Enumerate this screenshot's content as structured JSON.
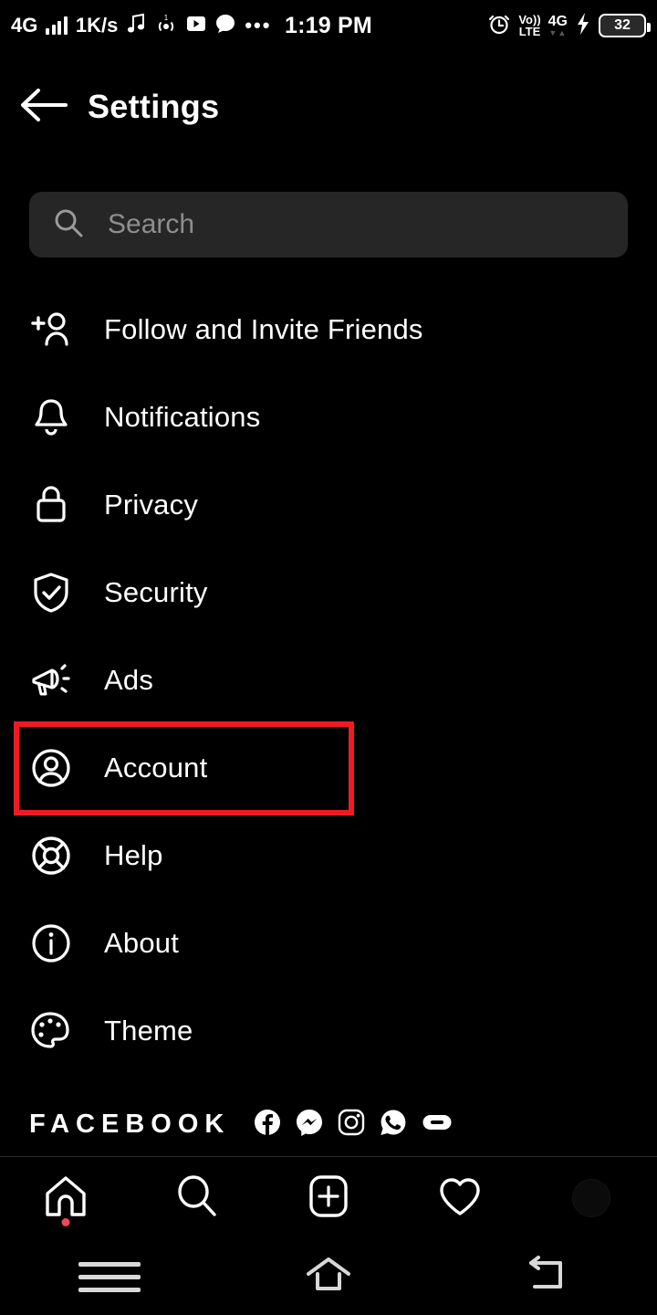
{
  "status_bar": {
    "network_type": "4G",
    "data_rate": "1K/s",
    "icons_left": [
      "signal-bars-icon",
      "music-note-icon",
      "vibrate-icon",
      "play-video-icon",
      "chat-bubble-icon",
      "more-dots-icon"
    ],
    "clock": "1:19 PM",
    "alarm_icon": "alarm-clock-icon",
    "volte_top": "Vo))",
    "volte_bottom": "LTE",
    "network_right": "4G",
    "data_arrows": "▼▲",
    "charging_icon": "charging-bolt-icon",
    "battery_level": "32"
  },
  "header": {
    "back_icon": "back-arrow-icon",
    "title": "Settings"
  },
  "search": {
    "icon": "search-icon",
    "placeholder": "Search",
    "value": ""
  },
  "menu": {
    "items": [
      {
        "label": "Follow and Invite Friends",
        "icon": "person-add-icon"
      },
      {
        "label": "Notifications",
        "icon": "bell-icon"
      },
      {
        "label": "Privacy",
        "icon": "lock-icon"
      },
      {
        "label": "Security",
        "icon": "shield-check-icon"
      },
      {
        "label": "Ads",
        "icon": "megaphone-icon"
      },
      {
        "label": "Account",
        "icon": "account-circle-icon"
      },
      {
        "label": "Help",
        "icon": "lifebuoy-icon"
      },
      {
        "label": "About",
        "icon": "info-circle-icon"
      },
      {
        "label": "Theme",
        "icon": "palette-icon"
      }
    ]
  },
  "highlight": {
    "target_label": "Account",
    "color": "#ED1C24"
  },
  "footer": {
    "brand": "FACEBOOK",
    "app_icons": [
      "facebook-icon",
      "messenger-icon",
      "instagram-icon",
      "whatsapp-icon",
      "oculus-icon"
    ]
  },
  "tab_bar": {
    "tabs": [
      {
        "name": "home",
        "icon": "home-icon",
        "badge": true
      },
      {
        "name": "search",
        "icon": "search-icon",
        "badge": false
      },
      {
        "name": "create",
        "icon": "plus-square-icon",
        "badge": false
      },
      {
        "name": "activity",
        "icon": "heart-icon",
        "badge": false
      },
      {
        "name": "profile",
        "icon": "avatar-icon",
        "badge": false
      }
    ]
  },
  "android_nav": {
    "buttons": [
      {
        "name": "recents",
        "icon": "menu-lines-icon"
      },
      {
        "name": "home",
        "icon": "home-outline-icon"
      },
      {
        "name": "back",
        "icon": "back-return-icon"
      }
    ]
  },
  "theme": {
    "background": "#000000",
    "text": "#FFFFFF",
    "muted_text": "#8E8E8E",
    "search_bg": "#262626",
    "accent_red": "#ED1C24",
    "badge_red": "#ED4956"
  }
}
